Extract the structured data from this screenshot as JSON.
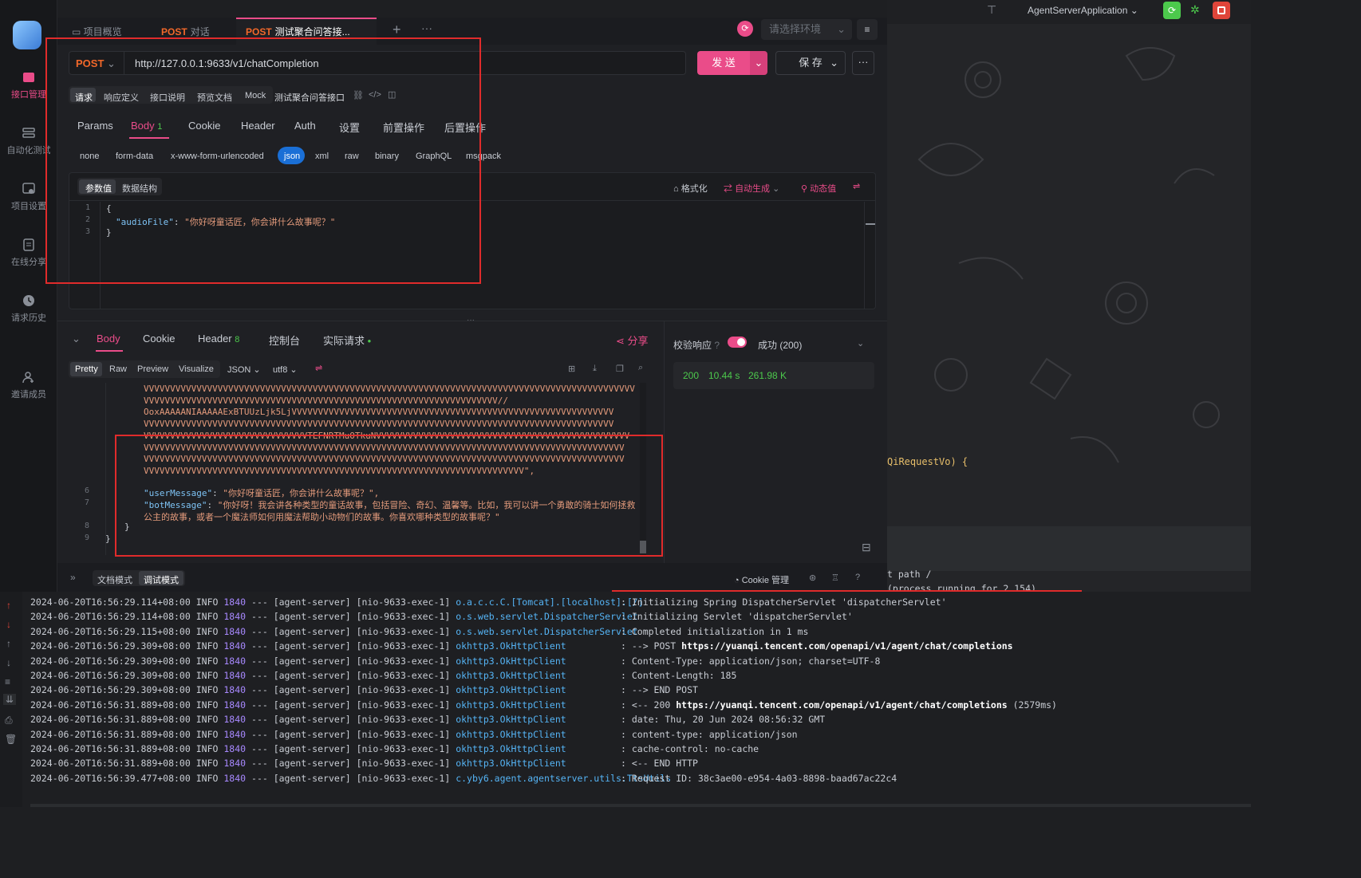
{
  "sidebar": {
    "items": [
      {
        "label": "接口管理",
        "icon": "api-icon",
        "active": true
      },
      {
        "label": "自动化测试",
        "icon": "stack-icon"
      },
      {
        "label": "项目设置",
        "icon": "settings-icon"
      },
      {
        "label": "在线分享",
        "icon": "share-doc-icon"
      },
      {
        "label": "请求历史",
        "icon": "history-icon"
      },
      {
        "label": "邀请成员",
        "icon": "add-user-icon"
      }
    ]
  },
  "tabs": [
    {
      "label": "项目概览"
    },
    {
      "method": "POST",
      "label": "对话"
    },
    {
      "method": "POST",
      "label": "测试聚合问答接..."
    }
  ],
  "env_placeholder": "请选择环境",
  "request": {
    "method": "POST",
    "url": "http://127.0.0.1:9633/v1/chatCompletion",
    "send": "发 送",
    "save": "保 存"
  },
  "mode_tabs": [
    "请求",
    "响应定义",
    "接口说明",
    "预览文档",
    "Mock"
  ],
  "api_name": "测试聚合问答接口",
  "req_tabs": [
    "Params",
    "Body",
    "Cookie",
    "Header",
    "Auth",
    "设置",
    "前置操作",
    "后置操作"
  ],
  "body_count": "1",
  "body_types": [
    "none",
    "form-data",
    "x-www-form-urlencoded",
    "json",
    "xml",
    "raw",
    "binary",
    "GraphQL",
    "msgpack"
  ],
  "param_tabs": [
    "参数值",
    "数据结构"
  ],
  "editor_tools": {
    "format": "格式化",
    "autogen": "自动生成",
    "dynamic": "动态值"
  },
  "request_body": {
    "lines": [
      {
        "n": "1",
        "text": "{"
      },
      {
        "n": "2",
        "key": "\"audioFile\"",
        "value": "\"你好呀童话匠，你会讲什么故事呢？\""
      },
      {
        "n": "3",
        "text": "}"
      }
    ]
  },
  "resp_tabs": [
    {
      "label": "Body"
    },
    {
      "label": "Cookie"
    },
    {
      "label": "Header",
      "count": "8"
    },
    {
      "label": "控制台"
    },
    {
      "label": "实际请求"
    }
  ],
  "share": "分享",
  "resp_format": {
    "views": [
      "Pretty",
      "Raw",
      "Preview",
      "Visualize"
    ],
    "lang": "JSON",
    "enc": "utf8"
  },
  "response_body": {
    "enc_lines": [
      "VVVVVVVVVVVVVVVVVVVVVVVVVVVVVVVVVVVVVVVVVVVVVVVVVVVVVVVVVVVVVVVVVVVVVVVVVVVVVVVVVVVVVVVVVVVVV",
      "VVVVVVVVVVVVVVVVVVVVVVVVVVVVVVVVVVVVVVVVVVVVVVVVVVVVVVVVVVVVVVVVVVV//",
      "OoxAAAAANIAAAAAExBTUUzLjk5LjVVVVVVVVVVVVVVVVVVVVVVVVVVVVVVVVVVVVVVVVVVVVVVVVVVVVVVVVVVVVV",
      "VVVVVVVVVVVVVVVVVVVVVVVVVVVVVVVVVVVVVVVVVVVVVVVVVVVVVVVVVVVVVVVVVVVVVVVVVVVVVVVVVVVVVVVVV",
      "VVVVVVVVVVVVVVVVVVVVVVVVVVVVVVVTEFNRTMuOTkuNVVVVVVVVVVVVVVVVVVVVVVVVVVVVVVVVVVVVVVVVVVVVVVVV",
      "VVVVVVVVVVVVVVVVVVVVVVVVVVVVVVVVVVVVVVVVVVVVVVVVVVVVVVVVVVVVVVVVVVVVVVVVVVVVVVVVVVVVVVVVVVV",
      "VVVVVVVVVVVVVVVVVVVVVVVVVVVVVVVVVVVVVVVVVVVVVVVVVVVVVVVVVVVVVVVVVVVVVVVVVVVVVVVVVVVVVVVVVVV",
      "VVVVVVVVVVVVVVVVVVVVVVVVVVVVVVVVVVVVVVVVVVVVVVVVVVVVVVVVVVVVVVVVVVVVVVVV\","
    ],
    "line6": {
      "n": "6",
      "key": "\"userMessage\"",
      "value": "\"你好呀童话匠，你会讲什么故事呢？\","
    },
    "line7": {
      "n": "7",
      "key": "\"botMessage\"",
      "value": "\"你好呀！我会讲各种类型的童话故事，包括冒险、奇幻、温馨等。比如，我可以讲一个勇敢的骑士如何拯救",
      "cont": "公主的故事，或者一个魔法师如何用魔法帮助小动物们的故事。你喜欢哪种类型的故事呢？\""
    },
    "line8": {
      "n": "8",
      "text": "}"
    },
    "line9": {
      "n": "9",
      "text": "}"
    }
  },
  "validation": {
    "label": "校验响应",
    "status": "成功 (200)"
  },
  "metrics": {
    "code": "200",
    "time": "10.44 s",
    "size": "261.98 K"
  },
  "bottom": {
    "modes": [
      "文档模式",
      "调试模式"
    ],
    "cookie": "Cookie 管理"
  },
  "ide": {
    "run_config": "AgentServerApplication",
    "code_snippet": "QiRequestVo) {",
    "tail1": "t path  /",
    "tail2": "(process running for 2.154)"
  },
  "logs": [
    {
      "ts": "2024-06-20T16:56:29.114+08:00",
      "lvl": "INFO",
      "pid": "1840",
      "th": "--- [agent-server] [nio-9633-exec-1]",
      "lg": "o.a.c.c.C.[Tomcat].[localhost].[/]",
      "m": ": Initializing Spring DispatcherServlet 'dispatcherServlet'"
    },
    {
      "ts": "2024-06-20T16:56:29.114+08:00",
      "lvl": "INFO",
      "pid": "1840",
      "th": "--- [agent-server] [nio-9633-exec-1]",
      "lg": "o.s.web.servlet.DispatcherServlet",
      "m": ": Initializing Servlet 'dispatcherServlet'"
    },
    {
      "ts": "2024-06-20T16:56:29.115+08:00",
      "lvl": "INFO",
      "pid": "1840",
      "th": "--- [agent-server] [nio-9633-exec-1]",
      "lg": "o.s.web.servlet.DispatcherServlet",
      "m": ": Completed initialization in 1 ms"
    },
    {
      "ts": "2024-06-20T16:56:29.309+08:00",
      "lvl": "INFO",
      "pid": "1840",
      "th": "--- [agent-server] [nio-9633-exec-1]",
      "lg": "okhttp3.OkHttpClient",
      "m": ": --> POST ",
      "b": "https://yuanqi.tencent.com/openapi/v1/agent/chat/completions"
    },
    {
      "ts": "2024-06-20T16:56:29.309+08:00",
      "lvl": "INFO",
      "pid": "1840",
      "th": "--- [agent-server] [nio-9633-exec-1]",
      "lg": "okhttp3.OkHttpClient",
      "m": ": Content-Type: application/json; charset=UTF-8"
    },
    {
      "ts": "2024-06-20T16:56:29.309+08:00",
      "lvl": "INFO",
      "pid": "1840",
      "th": "--- [agent-server] [nio-9633-exec-1]",
      "lg": "okhttp3.OkHttpClient",
      "m": ": Content-Length: 185"
    },
    {
      "ts": "2024-06-20T16:56:29.309+08:00",
      "lvl": "INFO",
      "pid": "1840",
      "th": "--- [agent-server] [nio-9633-exec-1]",
      "lg": "okhttp3.OkHttpClient",
      "m": ": --> END POST"
    },
    {
      "ts": "2024-06-20T16:56:31.889+08:00",
      "lvl": "INFO",
      "pid": "1840",
      "th": "--- [agent-server] [nio-9633-exec-1]",
      "lg": "okhttp3.OkHttpClient",
      "m": ": <-- 200 ",
      "b": "https://yuanqi.tencent.com/openapi/v1/agent/chat/completions",
      "t": " (2579ms)"
    },
    {
      "ts": "2024-06-20T16:56:31.889+08:00",
      "lvl": "INFO",
      "pid": "1840",
      "th": "--- [agent-server] [nio-9633-exec-1]",
      "lg": "okhttp3.OkHttpClient",
      "m": ": date: Thu, 20 Jun 2024 08:56:32 GMT"
    },
    {
      "ts": "2024-06-20T16:56:31.889+08:00",
      "lvl": "INFO",
      "pid": "1840",
      "th": "--- [agent-server] [nio-9633-exec-1]",
      "lg": "okhttp3.OkHttpClient",
      "m": ": content-type: application/json"
    },
    {
      "ts": "2024-06-20T16:56:31.889+08:00",
      "lvl": "INFO",
      "pid": "1840",
      "th": "--- [agent-server] [nio-9633-exec-1]",
      "lg": "okhttp3.OkHttpClient",
      "m": ": cache-control: no-cache"
    },
    {
      "ts": "2024-06-20T16:56:31.889+08:00",
      "lvl": "INFO",
      "pid": "1840",
      "th": "--- [agent-server] [nio-9633-exec-1]",
      "lg": "okhttp3.OkHttpClient",
      "m": ": <-- END HTTP"
    },
    {
      "ts": "2024-06-20T16:56:39.477+08:00",
      "lvl": "INFO",
      "pid": "1840",
      "th": "--- [agent-server] [nio-9633-exec-1]",
      "lg": "c.yby6.agent.agentserver.utils.TtsUtils",
      "m": ": Request ID: 38c3ae00-e954-4a03-8898-baad67ac22c4"
    }
  ],
  "colors": {
    "accent": "#ea4c89",
    "post": "#f2682a",
    "success": "#4cc94c",
    "highlight": "#e02b2b",
    "log_link": "#55b4f5"
  }
}
